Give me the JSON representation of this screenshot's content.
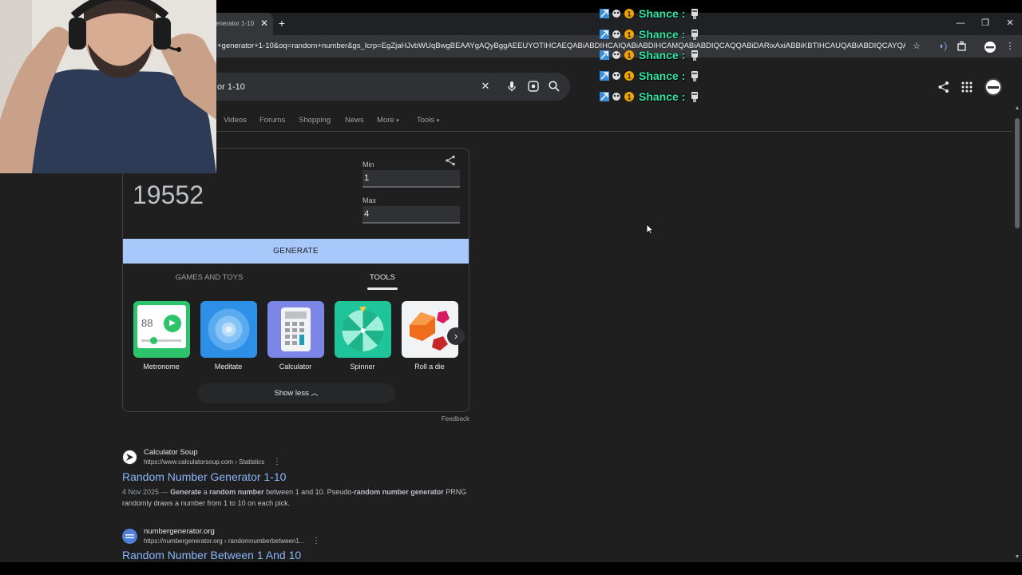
{
  "browser": {
    "tab_title": "enerator 1-10",
    "url": "+generator+1-10&oq=random+number&gs_lcrp=EgZjaHJvbWUqBwgBEAAYgAQyBggAEEUYOTIHCAEQABiABDIHCAIQABiABDIHCAMQABiABDIQCAQQABiDARixAxiABBiKBTIHCAUQABiABDIQCAYQABiDARixAx..."
  },
  "search": {
    "query": "or 1-10",
    "nav_tabs": [
      "Videos",
      "Forums",
      "Shopping",
      "News",
      "More",
      "Tools"
    ]
  },
  "rng": {
    "result": "19552",
    "min_label": "Min",
    "min_value": "1",
    "max_label": "Max",
    "max_value": "4",
    "generate_label": "GENERATE",
    "categories": [
      "GAMES AND TOYS",
      "TOOLS"
    ],
    "tools": [
      "Metronome",
      "Meditate",
      "Calculator",
      "Spinner",
      "Roll a die"
    ],
    "metronome_bpm": "88",
    "show_less_label": "Show less",
    "feedback_label": "Feedback"
  },
  "results": [
    {
      "site": "Calculator Soup",
      "cite": "https://www.calculatorsoup.com › Statistics",
      "title": "Random Number Generator 1-10",
      "date": "4 Nov 2025 —",
      "snippet_parts": [
        " ",
        "Generate",
        " a ",
        "random number",
        " between 1 and 10. Pseudo-",
        "random number generator",
        " PRNG randomly draws a number from 1 to 10 on each pick."
      ]
    },
    {
      "site": "numbergenerator.org",
      "cite": "https://numbergenerator.org › randomnumberbetween1...",
      "title": "Random Number Between 1 And 10"
    }
  ],
  "chat": {
    "username": "Shance :",
    "message_count": 5
  },
  "colors": {
    "background": "#1f1f1f",
    "link": "#8ab4f8",
    "generate_button": "#a8c7fa",
    "chat_name": "#2ee8a6"
  },
  "icons": [
    "close-icon",
    "plus-icon",
    "star-icon",
    "extensions-icon",
    "mic-icon",
    "lens-icon",
    "search-icon",
    "share-icon",
    "apps-grid-icon",
    "chevron-right-icon",
    "chevron-up-icon",
    "kebab-menu-icon"
  ]
}
